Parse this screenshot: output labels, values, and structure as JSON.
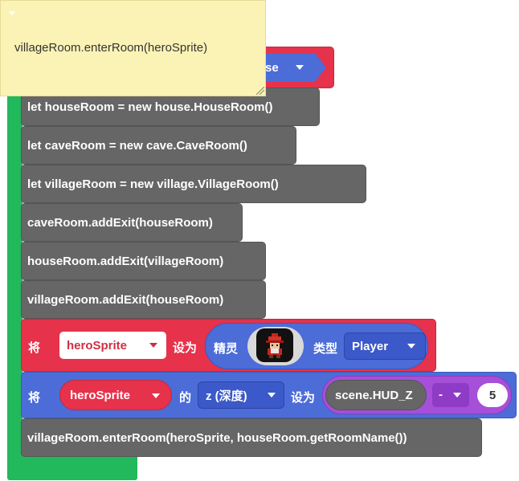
{
  "comment_note": {
    "text": "villageRoom.enterRoom(heroSprite)"
  },
  "top_block": {
    "dropdown_label": "se"
  },
  "lines": [
    "let houseRoom = new house.HouseRoom()",
    "let caveRoom = new cave.CaveRoom()",
    "let villageRoom = new village.VillageRoom()",
    "caveRoom.addExit(houseRoom)",
    "houseRoom.addExit(villageRoom)",
    "villageRoom.addExit(houseRoom)"
  ],
  "set_sprite_block": {
    "keyword": "将",
    "variable": "heroSprite",
    "set_to": "设为",
    "sprite_label": "精灵",
    "type_label": "类型",
    "kind": "Player"
  },
  "set_z_block": {
    "keyword": "将",
    "variable": "heroSprite",
    "of": "的",
    "property": "z (深度)",
    "set_to": "设为",
    "value_left": "scene.HUD_Z",
    "operator": "-",
    "value_right": "5"
  },
  "final_line": "villageRoom.enterRoom(heroSprite, houseRoom.getRoomName())",
  "colors": {
    "green": "#22b85c",
    "red": "#e6324b",
    "blue": "#4c6cd8",
    "gray": "#666666",
    "purple": "#a64fd9",
    "comment_bg": "#fbf3b5"
  }
}
